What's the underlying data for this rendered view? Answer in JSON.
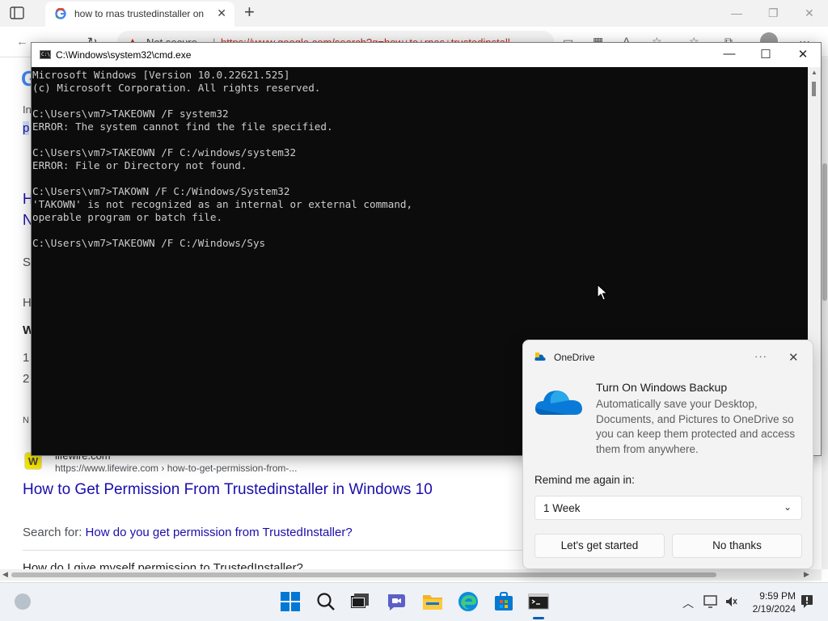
{
  "browser": {
    "tab_title": "how to rnas trustedinstaller on",
    "address": {
      "security_label": "Not secure",
      "url": "https://www.google.com/search?q=how+to+rnas+trustedinstall"
    }
  },
  "search_page": {
    "logo_letter": "G",
    "fragments": [
      "In",
      "p",
      "H",
      "N",
      "S",
      "H",
      "W",
      "1",
      "2",
      "N"
    ],
    "result": {
      "site_icon_letter": "W",
      "site_name": "lifewire.com",
      "site_url": "https://www.lifewire.com › how-to-get-permission-from-...",
      "title": "How to Get Permission From Trustedinstaller in Windows 10"
    },
    "search_for_label": "Search for:",
    "search_for_link": "How do you get permission from TrustedInstaller?",
    "cutoff_text": "How do I give myself permission to TrustedInstaller?"
  },
  "cmd": {
    "title": "C:\\Windows\\system32\\cmd.exe",
    "lines": [
      "Microsoft Windows [Version 10.0.22621.525]",
      "(c) Microsoft Corporation. All rights reserved.",
      "",
      "C:\\Users\\vm7>TAKEOWN /F system32",
      "ERROR: The system cannot find the file specified.",
      "",
      "C:\\Users\\vm7>TAKEOWN /F C:/windows/system32",
      "ERROR: File or Directory not found.",
      "",
      "C:\\Users\\vm7>TAKOWN /F C:/Windows/System32",
      "'TAKOWN' is not recognized as an internal or external command,",
      "operable program or batch file.",
      "",
      "C:\\Users\\vm7>TAKEOWN /F C:/Windows/Sys"
    ]
  },
  "toast": {
    "app_name": "OneDrive",
    "more_label": "···",
    "heading": "Turn On Windows Backup",
    "body": "Automatically save your Desktop, Documents, and Pictures to OneDrive so you can keep them protected and access them from anywhere.",
    "remind_label": "Remind me again in:",
    "remind_value": "1 Week",
    "primary_button": "Let's get started",
    "secondary_button": "No thanks"
  },
  "taskbar": {
    "apps": [
      "start-icon",
      "search-icon",
      "task-view-icon",
      "teams-chat-icon",
      "file-explorer-icon",
      "edge-icon",
      "store-icon",
      "cmd-icon"
    ],
    "time": "9:59 PM",
    "date": "2/19/2024"
  }
}
